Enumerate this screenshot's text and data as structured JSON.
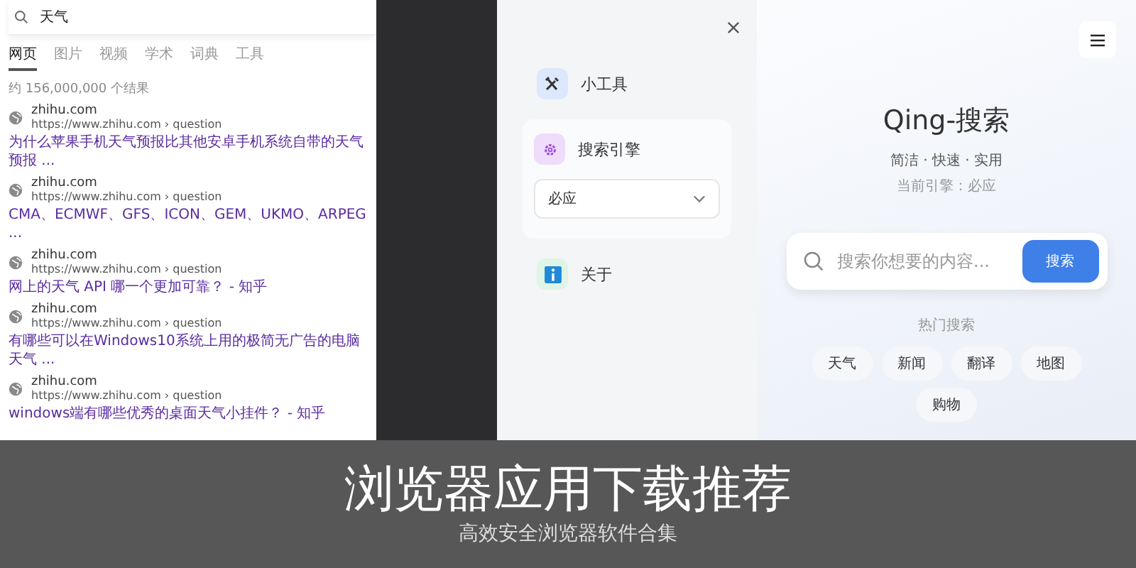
{
  "results_page": {
    "search": {
      "value": "天气"
    },
    "tabs": [
      {
        "label": "网页",
        "selected": true
      },
      {
        "label": "图片",
        "selected": false
      },
      {
        "label": "视频",
        "selected": false
      },
      {
        "label": "学术",
        "selected": false
      },
      {
        "label": "词典",
        "selected": false
      },
      {
        "label": "工具",
        "selected": false
      }
    ],
    "result_count": "约 156,000,000 个结果",
    "results": [
      {
        "site": "zhihu.com",
        "url": "https://www.zhihu.com › question",
        "title": "为什么苹果手机天气预报比其他安卓手机系统自带的天气预报 ..."
      },
      {
        "site": "zhihu.com",
        "url": "https://www.zhihu.com › question",
        "title": "CMA、ECMWF、GFS、ICON、GEM、UKMO、ARPEG ..."
      },
      {
        "site": "zhihu.com",
        "url": "https://www.zhihu.com › question",
        "title": "网上的天气 API 哪一个更加可靠？ - 知乎"
      },
      {
        "site": "zhihu.com",
        "url": "https://www.zhihu.com › question",
        "title": "有哪些可以在Windows10系统上用的极简无广告的电脑天气 ..."
      },
      {
        "site": "zhihu.com",
        "url": "https://www.zhihu.com › question",
        "title": "windows端有哪些优秀的桌面天气小挂件？ - 知乎"
      }
    ]
  },
  "menu_drawer": {
    "items": [
      {
        "kind": "link",
        "label": "小工具"
      },
      {
        "kind": "select",
        "label": "搜索引擎",
        "value": "必应"
      },
      {
        "kind": "link",
        "label": "关于"
      }
    ]
  },
  "home": {
    "title": "Qing-搜索",
    "tagline": "简洁 · 快速 · 实用",
    "engine": "当前引擎：必应",
    "search": {
      "placeholder": "搜索你想要的内容...",
      "button": "搜索"
    },
    "hot_label": "热门搜索",
    "hot": [
      "天气",
      "新闻",
      "翻译",
      "地图",
      "购物"
    ]
  },
  "banner": {
    "title": "浏览器应用下载推荐",
    "subtitle": "高效安全浏览器软件合集"
  }
}
